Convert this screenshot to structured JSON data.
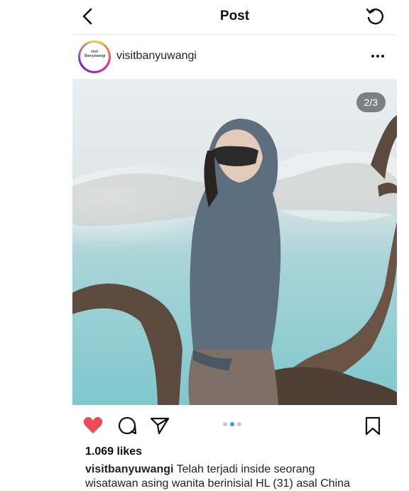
{
  "topbar": {
    "title": "Post"
  },
  "post": {
    "username": "visitbanyuwangi",
    "avatar_text": "visit Banyuwangi",
    "photo_counter": "2/3",
    "carousel": {
      "total": 3,
      "active_index": 1
    },
    "likes": "1.069 likes",
    "caption_username": "visitbanyuwangi",
    "caption_text": "Telah terjadi inside seorang wisatawan asing wanita berinisial HL (31) asal China"
  },
  "colors": {
    "like_red": "#ed4956",
    "dot_active": "#3897f0",
    "dot_inactive": "#c8c8c8"
  }
}
